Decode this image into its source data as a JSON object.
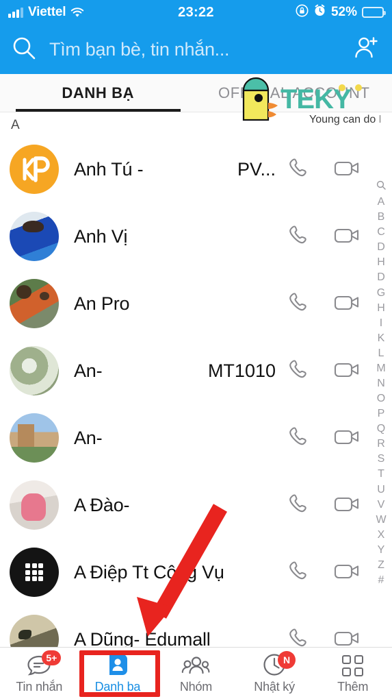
{
  "status_bar": {
    "carrier": "Viettel",
    "time": "23:22",
    "battery_percent": "52%",
    "battery_level": 52,
    "icons": [
      "signal-icon",
      "wifi-icon",
      "rotation-lock-icon",
      "alarm-icon",
      "battery-icon"
    ]
  },
  "search": {
    "placeholder": "Tìm bạn bè, tin nhắn...",
    "value": ""
  },
  "tabs": [
    {
      "label": "DANH BẠ",
      "active": true
    },
    {
      "label": "OFFICIAL ACCOUNT",
      "active": false
    }
  ],
  "section_header": "A",
  "contacts": [
    {
      "name": "Anh Tú -",
      "tag": "PV...",
      "avatar": "kp-logo"
    },
    {
      "name": "Anh Vị",
      "tag": "",
      "avatar": "photo-boy-blue"
    },
    {
      "name": "An Pro",
      "tag": "",
      "avatar": "photo-two-men-orange"
    },
    {
      "name": "An-",
      "tag": "MT1010",
      "avatar": "photo-plant"
    },
    {
      "name": "An-",
      "tag": "",
      "avatar": "photo-building"
    },
    {
      "name": "A Đào-",
      "tag": "",
      "avatar": "photo-child-pink"
    },
    {
      "name": "A Điệp Tt Công Vụ",
      "tag": "",
      "avatar": "blackberry-logo"
    },
    {
      "name": "A Dũng- Edumall",
      "tag": "",
      "avatar": "photo-landscape"
    }
  ],
  "row_actions": {
    "call": "phone-icon",
    "video": "video-camera-icon"
  },
  "alpha_index": [
    "Q",
    "A",
    "B",
    "C",
    "D",
    "H",
    "D",
    "G",
    "H",
    "I",
    "K",
    "L",
    "M",
    "N",
    "O",
    "P",
    "Q",
    "R",
    "S",
    "T",
    "U",
    "V",
    "W",
    "X",
    "Y",
    "Z",
    "#"
  ],
  "watermark": {
    "brand": "TEKY",
    "tagline": "Young can do IT",
    "brand_color": "#45B8A4",
    "body_color": "#F2E85C",
    "beak_color": "#F08B33"
  },
  "annotations": {
    "arrow_color": "#E8241F",
    "highlight_color": "#E8241F",
    "highlight_target": "Danh ba"
  },
  "bottom_nav": [
    {
      "label": "Tin nhắn",
      "icon": "chat-bubble-icon",
      "badge": "5+",
      "active": false
    },
    {
      "label": "Danh ba",
      "icon": "contacts-card-icon",
      "badge": "",
      "active": true
    },
    {
      "label": "Nhóm",
      "icon": "group-icon",
      "badge": "",
      "active": false
    },
    {
      "label": "Nhật ký",
      "icon": "clock-icon",
      "badge": "N",
      "active": false
    },
    {
      "label": "Thêm",
      "icon": "grid-more-icon",
      "badge": "",
      "active": false
    }
  ],
  "colors": {
    "header_blue": "#159CEC",
    "active_blue": "#1A8FE3",
    "badge_red": "#EF3B36"
  }
}
